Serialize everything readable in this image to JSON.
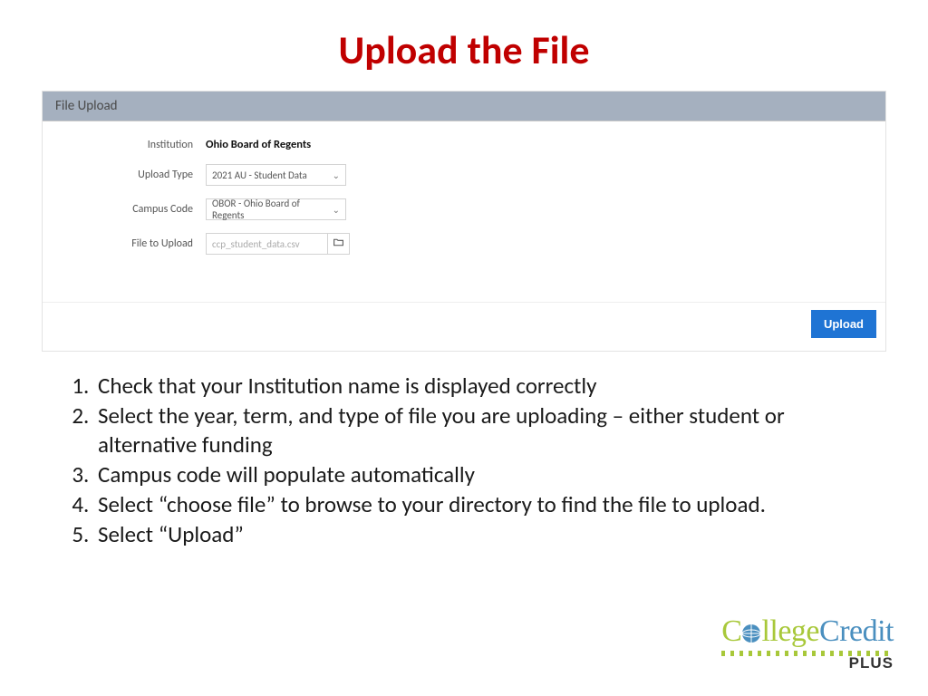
{
  "title": "Upload the File",
  "form": {
    "header": "File Upload",
    "institution_label": "Institution",
    "institution_value": "Ohio Board of Regents",
    "upload_type_label": "Upload Type",
    "upload_type_value": "2021 AU - Student Data",
    "campus_code_label": "Campus Code",
    "campus_code_value": "OBOR - Ohio Board of Regents",
    "file_label": "File to Upload",
    "file_value": "ccp_student_data.csv",
    "upload_button": "Upload"
  },
  "instructions": [
    "Check that your Institution name is displayed correctly",
    "Select the year, term, and type of file you are uploading – either student or alternative funding",
    "Campus code will populate automatically",
    "Select “choose file” to browse to your directory to find the file to upload.",
    "Select “Upload”"
  ],
  "logo": {
    "part1": "C",
    "part2": "llege",
    "part3": "Credit",
    "sub": "PLUS"
  }
}
